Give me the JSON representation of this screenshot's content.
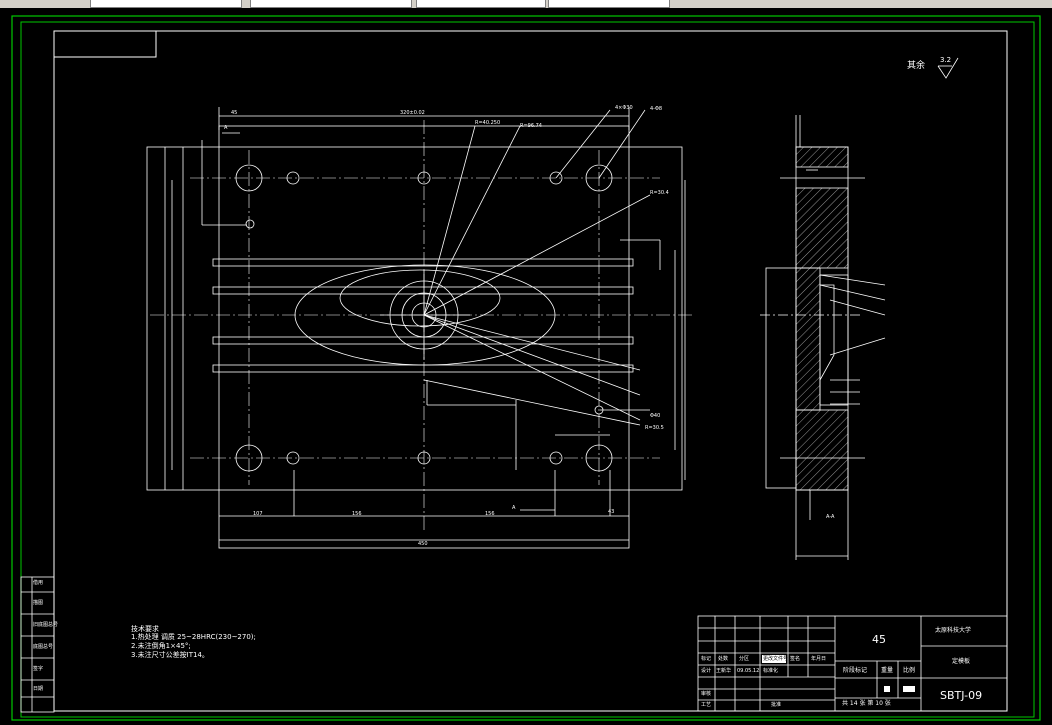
{
  "toolbar": {
    "fields": [
      "",
      "",
      "",
      ""
    ]
  },
  "drawing": {
    "roughness_label": "其余",
    "roughness_value": "3.2",
    "notes": [
      "技术要求",
      "1.热处理 调质 25~28HRC(230~270);",
      "2.未注倒角1×45°;",
      "3.未注尺寸公差按IT14。"
    ],
    "dims": {
      "top_width": "320±0.02",
      "left_45": "45",
      "bottom_total": "450",
      "bottom_1": "107",
      "bottom_2": "156",
      "bottom_3": "156",
      "bottom_4": "43",
      "section_a": "A",
      "callout_1": "R=40.250",
      "callout_2": "R=96.74",
      "callout_3": "4×Φ30",
      "callout_4": "4-Φ8",
      "callout_5": "R=30.4",
      "callout_6": "Φ40",
      "callout_7": "R=30.5",
      "section_view_label": "A-A"
    }
  },
  "title_block": {
    "material": "45",
    "school": "太原科技大学",
    "part_name": "定模板",
    "drawing_no": "SBTJ-09",
    "sheet_info": "共 14 张  第 10 张",
    "stage_label": "阶段标记",
    "weight_label": "重量",
    "scale_label": "比例",
    "design_row": [
      "设计",
      "王新华",
      "09.05.12",
      "标准化"
    ],
    "mark_row": [
      "标记",
      "处数",
      "分区",
      "更改文件号",
      "签名",
      "年月日"
    ],
    "review_label": "审核",
    "process_label": "工艺",
    "approve_label": "批准"
  },
  "side_panel": [
    "借用",
    "描图",
    "旧底图总号",
    "底图总号",
    "签字",
    "日期"
  ]
}
